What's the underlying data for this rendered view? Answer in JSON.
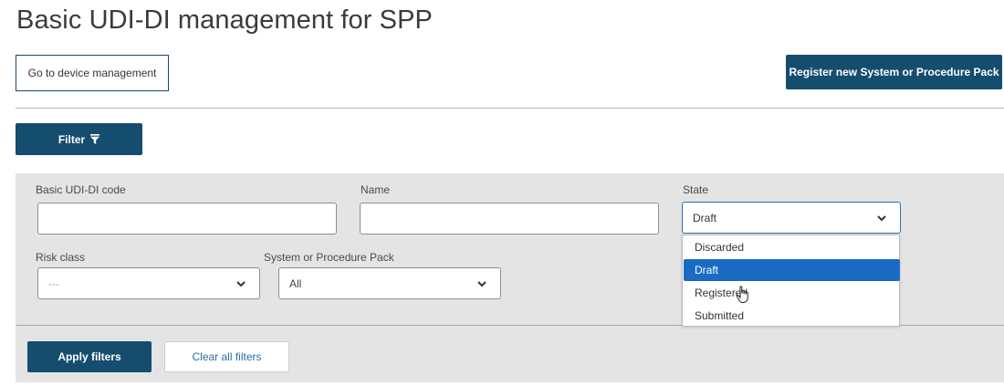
{
  "header": {
    "title": "Basic UDI-DI management for SPP",
    "device_management_label": "Go to device management",
    "register_label": "Register new System or Procedure Pack"
  },
  "filter_toggle": {
    "label": "Filter",
    "icon": "funnel-icon"
  },
  "filters": {
    "basic_udi_di_code": {
      "label": "Basic UDI-DI code",
      "value": ""
    },
    "name": {
      "label": "Name",
      "value": ""
    },
    "state": {
      "label": "State",
      "selected": "Draft",
      "options": [
        "Discarded",
        "Draft",
        "Registered",
        "Submitted"
      ],
      "highlighted_option": "Draft"
    },
    "risk_class": {
      "label": "Risk class",
      "selected": "---"
    },
    "system_or_procedure_pack": {
      "label": "System or Procedure Pack",
      "selected": "All"
    }
  },
  "actions": {
    "apply_label": "Apply filters",
    "clear_label": "Clear all filters"
  },
  "colors": {
    "primary": "#154d6e",
    "panel_bg": "#e4e4e4",
    "selected_option": "#1a6bc4",
    "link": "#2a6ea8"
  }
}
